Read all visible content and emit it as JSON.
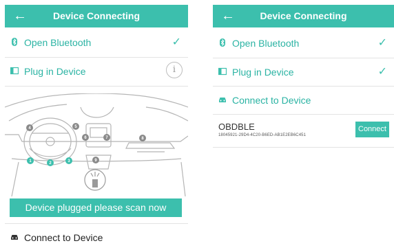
{
  "colors": {
    "accent": "#3cbfad",
    "text": "#3a3a3a"
  },
  "left": {
    "header": {
      "back_icon": "arrow-left-icon",
      "back_glyph": "←",
      "title": "Device Connecting"
    },
    "steps": [
      {
        "icon": "bluetooth-icon",
        "label": "Open Bluetooth",
        "status": "done"
      },
      {
        "icon": "plug-device-icon",
        "label": "Plug in Device",
        "status": "active"
      }
    ],
    "info_glyph": "i",
    "check_glyph": "✓",
    "port_numbers": [
      "1",
      "2",
      "3",
      "4",
      "5",
      "6",
      "7",
      "8",
      "9"
    ],
    "scan_button": "Device plugged please scan now",
    "connect_step": {
      "icon": "car-icon",
      "label": "Connect to Device"
    }
  },
  "right": {
    "header": {
      "back_icon": "arrow-left-icon",
      "back_glyph": "←",
      "title": "Device Connecting"
    },
    "steps": [
      {
        "icon": "bluetooth-icon",
        "label": "Open Bluetooth",
        "status": "done"
      },
      {
        "icon": "plug-device-icon",
        "label": "Plug in Device",
        "status": "done"
      },
      {
        "icon": "car-icon",
        "label": "Connect to Device",
        "status": "active"
      }
    ],
    "check_glyph": "✓",
    "device": {
      "name": "OBDBLE",
      "id": "18045921-29D4-4C20-B6ED-AB1E2EB6C451",
      "connect_label": "Connect"
    }
  }
}
